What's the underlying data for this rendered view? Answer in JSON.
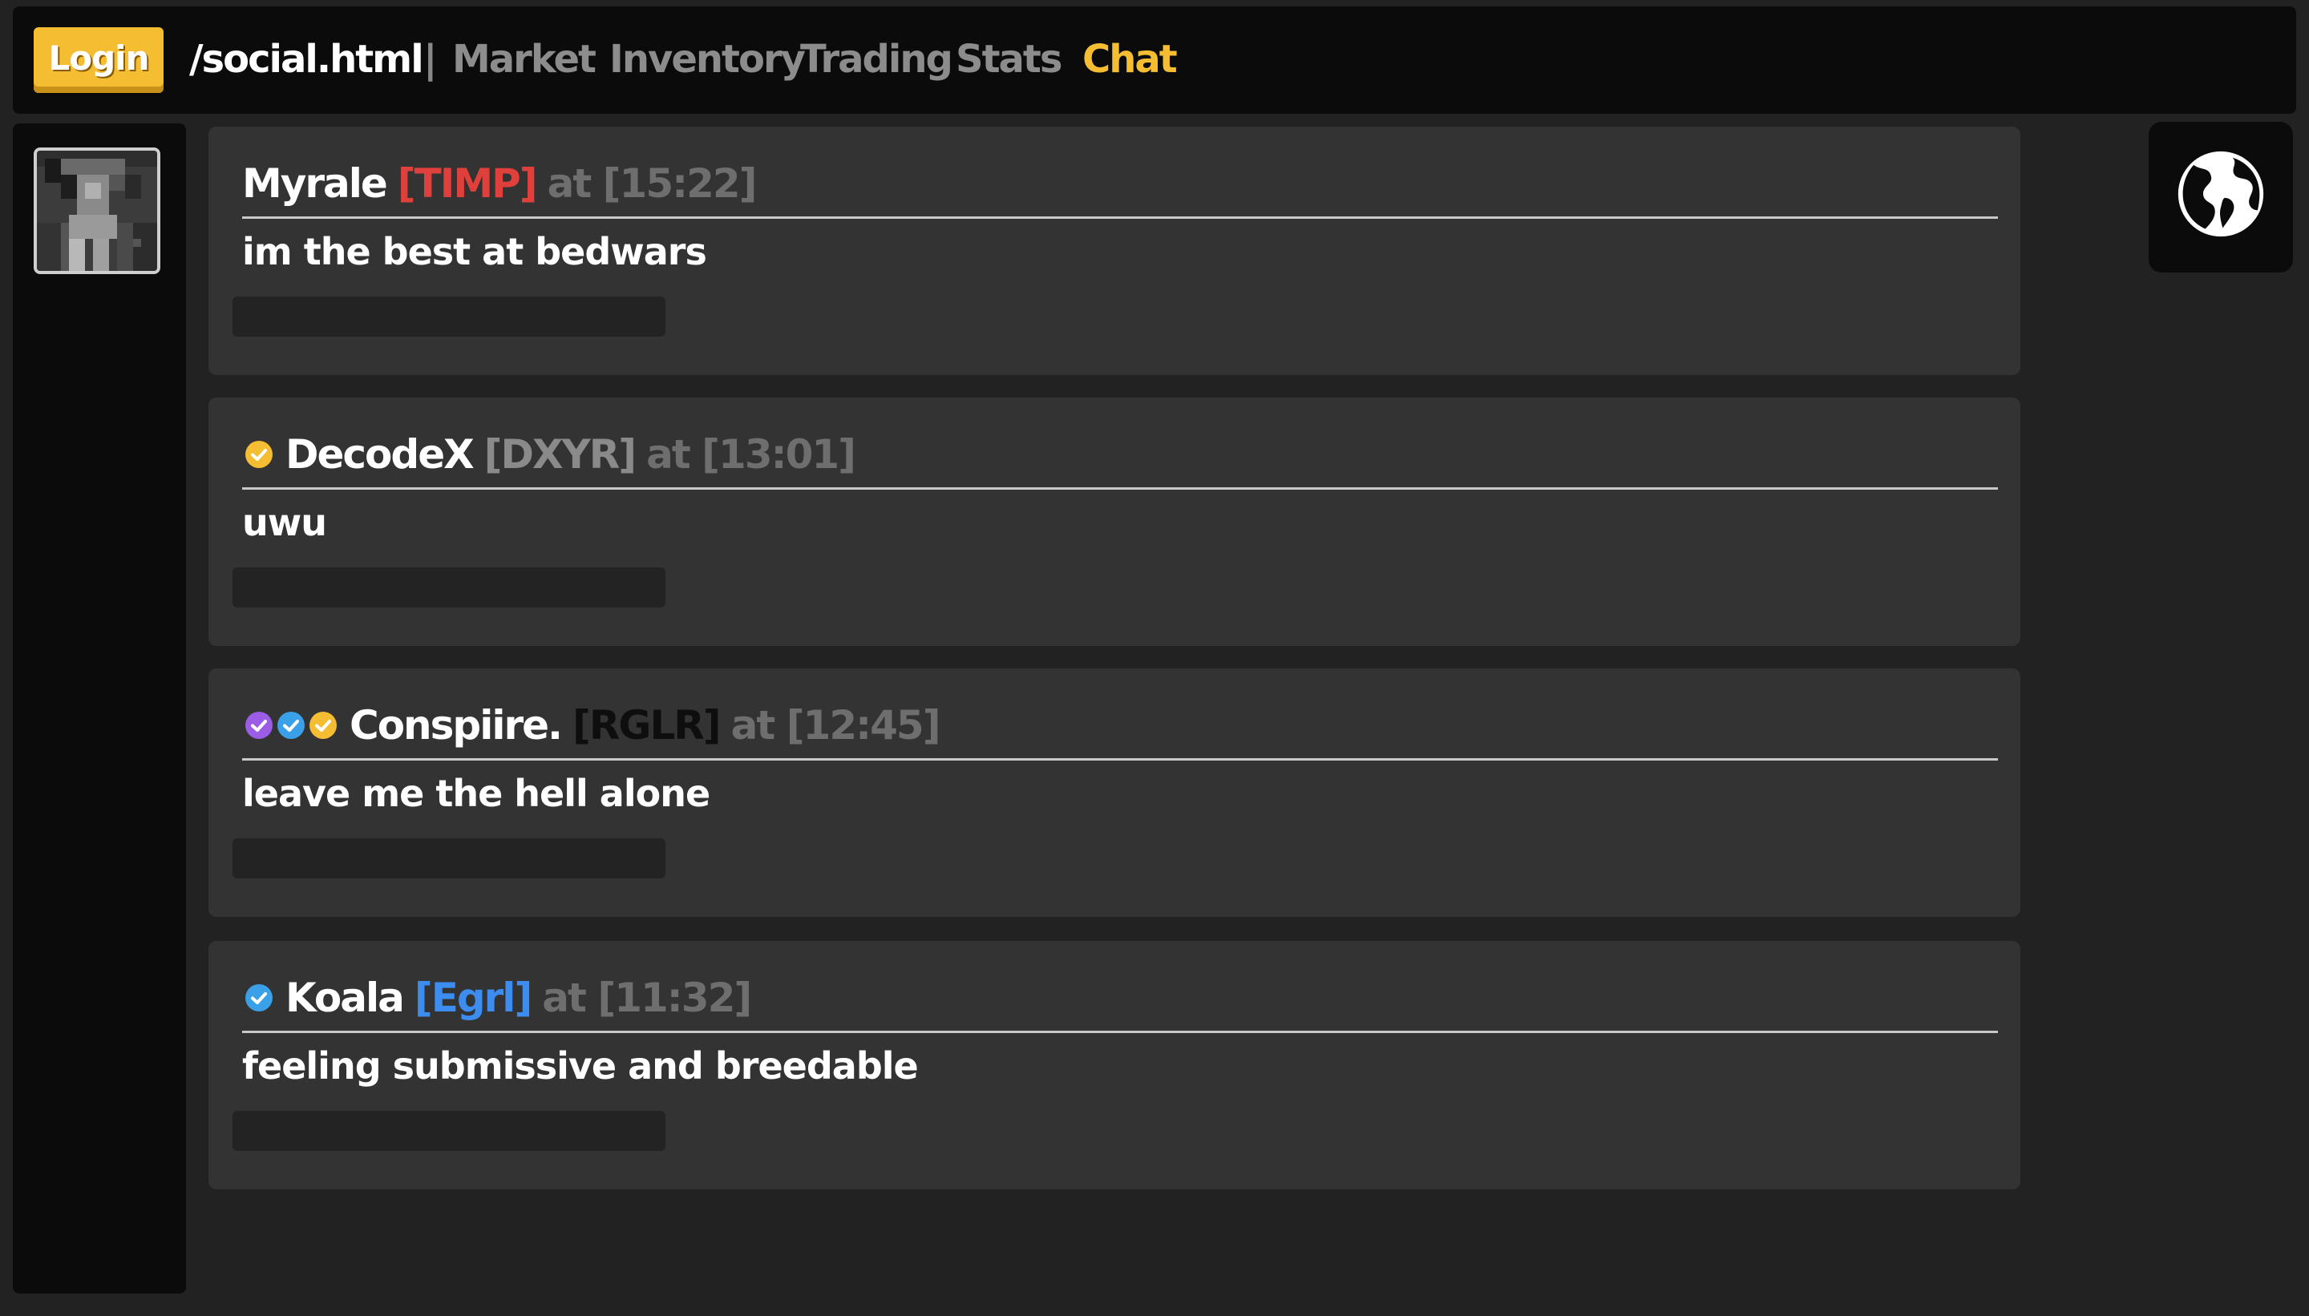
{
  "nav": {
    "login_label": "Login",
    "path": "/social.html",
    "separator": "|",
    "links": [
      {
        "label": "Market",
        "active": false
      },
      {
        "label": "Inventory",
        "active": false
      },
      {
        "label": "Trading",
        "active": false
      },
      {
        "label": "Stats",
        "active": false
      },
      {
        "label": "Chat",
        "active": true
      }
    ]
  },
  "sidebar": {
    "avatar_icon": "player-skin-avatar"
  },
  "globe_button": {
    "icon": "globe-icon"
  },
  "messages": [
    {
      "badges": [],
      "user": "Myrale",
      "tag": "[TIMP]",
      "tag_color": "#e0403c",
      "time": "at [15:22]",
      "text": "im the best at bedwars"
    },
    {
      "badges": [
        "gold-check-badge-icon"
      ],
      "user": "DecodeX",
      "tag": "[DXYR]",
      "tag_color": "#8a8a8a",
      "time": "at [13:01]",
      "text": "uwu"
    },
    {
      "badges": [
        "purple-check-badge-icon",
        "blue-check-badge-icon",
        "gold-check-badge-icon"
      ],
      "user": "Conspiire.",
      "tag": "[RGLR]",
      "tag_color": "#0e0e0e",
      "time": "at [12:45]",
      "text": "leave me the hell alone"
    },
    {
      "badges": [
        "blue-check-badge-icon"
      ],
      "user": "Koala",
      "tag": "[Egrl]",
      "tag_color": "#3d8cf0",
      "time": "at [11:32]",
      "text": "feeling submissive and breedable"
    }
  ],
  "colors": {
    "accent": "#f5bd32",
    "badge_gold": "#f5bd32",
    "badge_blue": "#3aa0e8",
    "badge_purple": "#9b5de5"
  }
}
